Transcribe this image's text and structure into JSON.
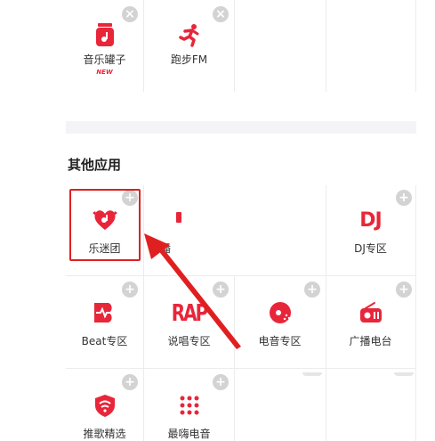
{
  "top_row": [
    {
      "label": "音乐罐子",
      "badge": "NEW",
      "icon": "jar-icon"
    },
    {
      "label": "跑步FM",
      "icon": "running-icon"
    }
  ],
  "section": {
    "title": "其他应用"
  },
  "apps_row1": [
    {
      "label": "乐迷团",
      "icon": "heart-shield-icon"
    },
    {
      "label": "播",
      "icon": "partial-icon"
    },
    {
      "label": "DJ专区",
      "icon": "dj-icon"
    }
  ],
  "apps_row2": [
    {
      "label": "Beat专区",
      "icon": "beat-icon"
    },
    {
      "label": "说唱专区",
      "icon": "rap-icon"
    },
    {
      "label": "电音专区",
      "icon": "electronic-disc-icon"
    },
    {
      "label": "广播电台",
      "icon": "radio-icon"
    }
  ],
  "apps_row3": [
    {
      "label": "推歌精选",
      "icon": "recommend-icon"
    },
    {
      "label": "最嗨电音",
      "icon": "dots-icon"
    }
  ],
  "action_symbols": {
    "remove": "×",
    "add": "+"
  },
  "icon_text": {
    "dj": "DJ",
    "rap": "RAP"
  },
  "colors": {
    "accent": "#e8263a",
    "annotation": "#e02020"
  }
}
